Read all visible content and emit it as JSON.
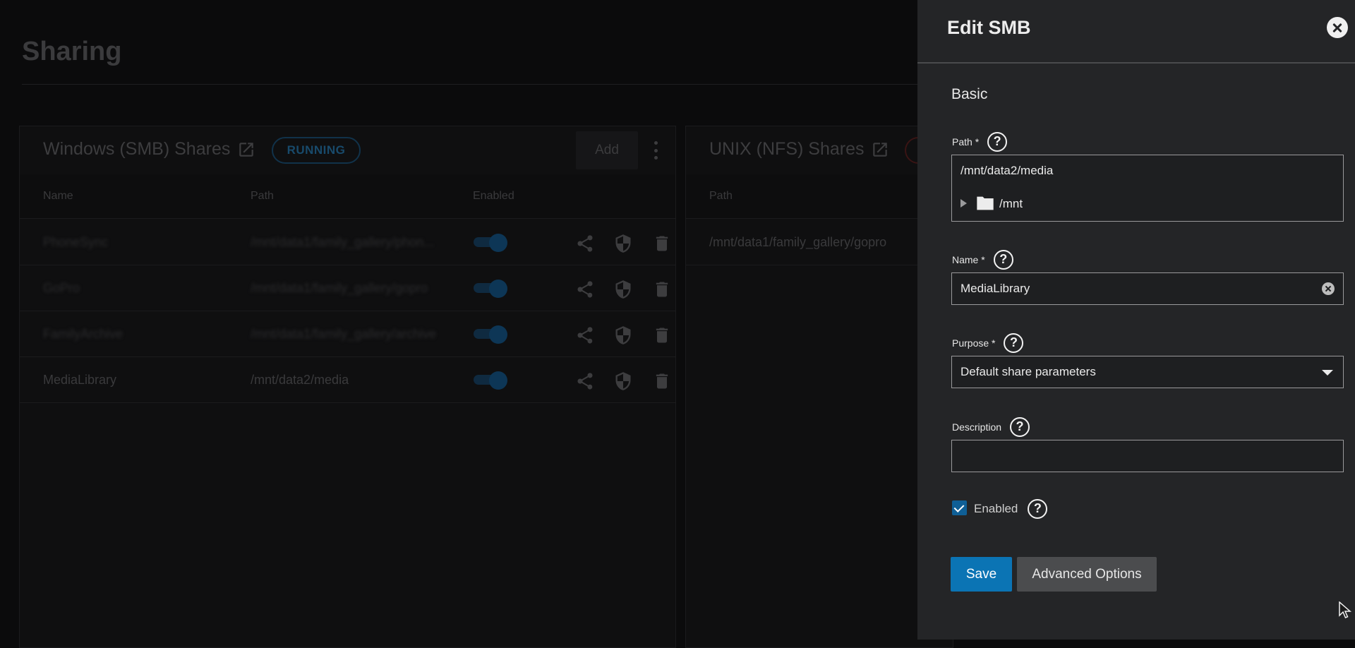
{
  "page": {
    "title": "Sharing"
  },
  "smb_card": {
    "title": "Windows (SMB) Shares",
    "status": "RUNNING",
    "add_label": "Add",
    "columns": [
      "Name",
      "Path",
      "Enabled"
    ],
    "rows": [
      {
        "name": "PhoneSync",
        "path": "/mnt/data1/family_gallery/phon...",
        "enabled": true
      },
      {
        "name": "GoPro",
        "path": "/mnt/data1/family_gallery/gopro",
        "enabled": true
      },
      {
        "name": "FamilyArchive",
        "path": "/mnt/data1/family_gallery/archive",
        "enabled": true
      },
      {
        "name": "MediaLibrary",
        "path": "/mnt/data2/media",
        "enabled": true
      }
    ]
  },
  "nfs_card": {
    "title": "UNIX (NFS) Shares",
    "columns": [
      "Path"
    ],
    "rows": [
      {
        "path": "/mnt/data1/family_gallery/gopro"
      }
    ]
  },
  "drawer": {
    "title": "Edit SMB",
    "section": "Basic",
    "path_label": "Path *",
    "path_value": "/mnt/data2/media",
    "tree_item": "/mnt",
    "name_label": "Name *",
    "name_value": "MediaLibrary",
    "purpose_label": "Purpose *",
    "purpose_value": "Default share parameters",
    "description_label": "Description",
    "description_value": "",
    "enabled_label": "Enabled",
    "enabled_checked": true,
    "save_label": "Save",
    "advanced_label": "Advanced Options",
    "help_glyph": "?"
  },
  "colors": {
    "accent": "#0b74b4",
    "drawer_bg": "#242527",
    "page_bg": "#0b0b0c"
  },
  "icons": [
    "external-link-icon",
    "share-icon",
    "shield-icon",
    "trash-icon",
    "help-icon",
    "close-icon",
    "folder-icon",
    "caret-down-icon",
    "cursor-icon"
  ]
}
